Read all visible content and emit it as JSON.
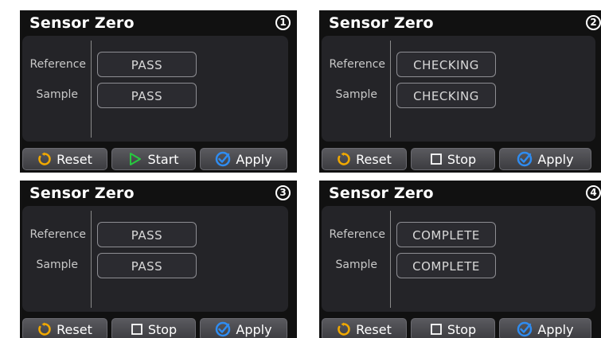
{
  "colors": {
    "reset_icon": "#f0a800",
    "start_icon": "#27c93f",
    "apply_icon": "#2f8cf0",
    "panel_bg": "#111111",
    "content_bg": "#242428"
  },
  "panels": [
    {
      "title": "Sensor Zero",
      "step": "1",
      "reference_label": "Reference",
      "sample_label": "Sample",
      "reference_status": "PASS",
      "sample_status": "PASS",
      "buttons": {
        "reset": "Reset",
        "action": "Start",
        "action_icon": "play-icon",
        "apply": "Apply"
      }
    },
    {
      "title": "Sensor Zero",
      "step": "2",
      "reference_label": "Reference",
      "sample_label": "Sample",
      "reference_status": "CHECKING",
      "sample_status": "CHECKING",
      "buttons": {
        "reset": "Reset",
        "action": "Stop",
        "action_icon": "stop-icon",
        "apply": "Apply"
      }
    },
    {
      "title": "Sensor Zero",
      "step": "3",
      "reference_label": "Reference",
      "sample_label": "Sample",
      "reference_status": "PASS",
      "sample_status": "PASS",
      "buttons": {
        "reset": "Reset",
        "action": "Stop",
        "action_icon": "stop-icon",
        "apply": "Apply"
      }
    },
    {
      "title": "Sensor Zero",
      "step": "4",
      "reference_label": "Reference",
      "sample_label": "Sample",
      "reference_status": "COMPLETE",
      "sample_status": "COMPLETE",
      "buttons": {
        "reset": "Reset",
        "action": "Stop",
        "action_icon": "stop-icon",
        "apply": "Apply"
      }
    }
  ]
}
